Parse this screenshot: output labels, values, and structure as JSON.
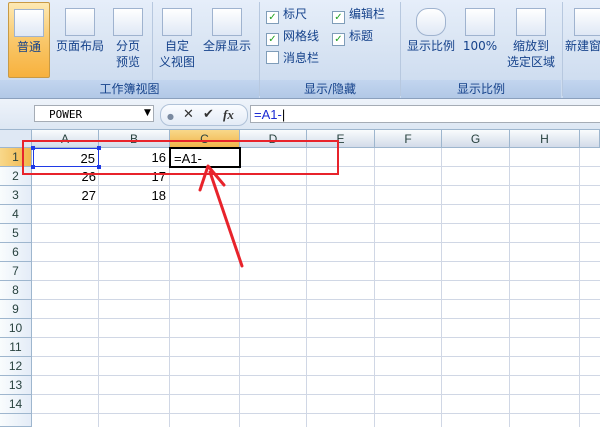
{
  "ribbon": {
    "workbook_views": {
      "label": "工作簿视图",
      "normal": "普通",
      "page_layout": "页面布局",
      "page_break_line1": "分页",
      "page_break_line2": "预览",
      "custom_line1": "自定",
      "custom_line2": "义视图",
      "full_screen": "全屏显示"
    },
    "show_hide": {
      "label": "显示/隐藏",
      "ruler": "标尺",
      "formula_bar": "编辑栏",
      "gridlines": "网格线",
      "headings": "标题",
      "message_bar": "消息栏"
    },
    "zoom": {
      "label": "显示比例",
      "zoom": "显示比例",
      "hundred": "100%",
      "zoom_sel_line1": "缩放到",
      "zoom_sel_line2": "选定区域"
    },
    "window": {
      "new_window": "新建窗"
    }
  },
  "formula_bar": {
    "name_box": "POWER",
    "cancel_icon": "✕",
    "enter_icon": "✔",
    "fx_icon": "fx",
    "formula": "=A1-"
  },
  "grid": {
    "columns": [
      "A",
      "B",
      "C",
      "D",
      "E",
      "F",
      "G",
      "H"
    ],
    "rows": [
      "1",
      "2",
      "3",
      "4",
      "5",
      "6",
      "7",
      "8",
      "9",
      "10",
      "11",
      "12",
      "13",
      "14"
    ],
    "cells": {
      "A1": "25",
      "B1": "16",
      "C1": "=A1-",
      "A2": "26",
      "B2": "17",
      "A3": "27",
      "B3": "18"
    }
  },
  "colors": {
    "annotation_red": "#e8232b",
    "selection_orange": "#f1b54a",
    "reference_blue": "#1f3ae6"
  }
}
